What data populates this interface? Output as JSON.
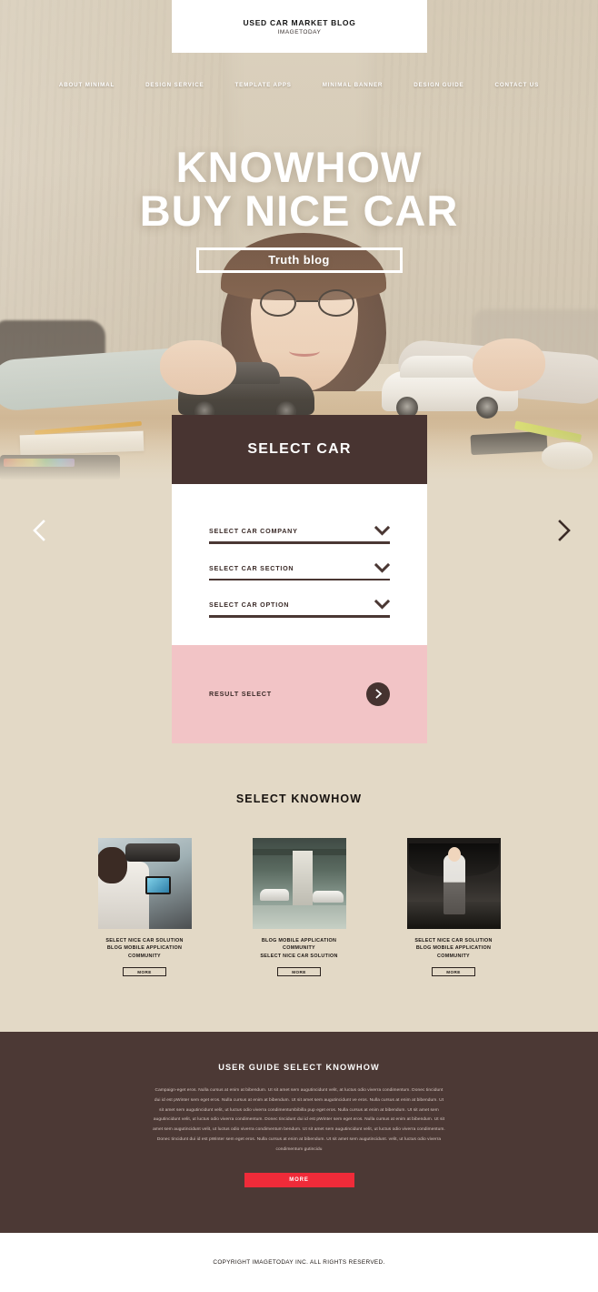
{
  "logo": {
    "title": "USED CAR MARKET BLOG",
    "subtitle": "IMAGETODAY"
  },
  "nav": {
    "items": [
      {
        "label": "ABOUT MINIMAL"
      },
      {
        "label": "DESIGN SERVICE"
      },
      {
        "label": "TEMPLATE APPS"
      },
      {
        "label": "MINIMAL BANNER"
      },
      {
        "label": "DESIGN GUIDE"
      },
      {
        "label": "CONTACT US"
      }
    ]
  },
  "hero": {
    "heading_line1": "KNOWHOW",
    "heading_line2": "BUY NICE CAR",
    "badge": "Truth blog",
    "prev_icon": "chevron-left-icon",
    "next_icon": "chevron-right-icon"
  },
  "select_car": {
    "title": "SELECT CAR",
    "fields": [
      {
        "label": "SELECT CAR COMPANY",
        "icon": "chevron-down-icon"
      },
      {
        "label": "SELECT CAR SECTION",
        "icon": "chevron-down-icon"
      },
      {
        "label": "SELECT CAR OPTION",
        "icon": "chevron-down-icon"
      }
    ],
    "result_label": "RESULT SELECT",
    "result_icon": "chevron-right-icon",
    "header_color": "#483431",
    "footer_color": "#f2c4c6"
  },
  "knowhow": {
    "title": "SELECT KNOWHOW",
    "cards": [
      {
        "caption_line1": "SELECT NICE CAR SOLUTION",
        "caption_line2": "BLOG MOBILE APPLICATION COMMUNITY",
        "button": "MORE",
        "image": "driver-using-navigation-photo"
      },
      {
        "caption_line1": "BLOG MOBILE APPLICATION COMMUNITY",
        "caption_line2": "SELECT NICE CAR SOLUTION",
        "button": "MORE",
        "image": "parking-garage-photo"
      },
      {
        "caption_line1": "SELECT NICE CAR SOLUTION",
        "caption_line2": "BLOG MOBILE APPLICATION COMMUNITY",
        "button": "MORE",
        "image": "woman-open-car-hood-photo"
      }
    ]
  },
  "guide": {
    "title": "USER GUIDE SELECT KNOWHOW",
    "body": "Campaign-eget eros. Nulla cursus at enim at bibendum. Ut sit amet sem augutincidunt velit, at luctus odio viverra condimentum. Donec tincidunt dui id est pWinter sem eget eros. Nulla cursus at enim at bibendum. Ut sit amet sem augutincidunt ve eros. Nulla cursus at enim at bibendum. Ut sit amet sem augutincidunt velit, ut luctus odio viverra condimentumbibilla pup eget eros. Nulla cursus at enim at bibendum. Ut sit amet sem augutincidunt velit, ut luctus odio viverra condimentum. Donec tincidunt dui id est pWinter sem eget eros. Nulla cursus at enim at bibendum. Ut sit amet sem augutincidunt velit, ut luctus odio viverra condimentum bendum. Ut sit amet sem augutincidunt velit, ut luctus odio viverra condimentum. Donec tincidunt dui id est pWinter sem eget eros. Nulla cursus at enim at bibendum. Ut sit amet sem augutincidunt. velit, ut luctus odio viverra condimentum gutincidu",
    "button": "MORE",
    "button_color": "#ef2b39",
    "background_color": "#4c3935"
  },
  "footer": {
    "copyright": "COPYRIGHT IMAGETODAY INC. ALL RIGHTS RESERVED."
  }
}
